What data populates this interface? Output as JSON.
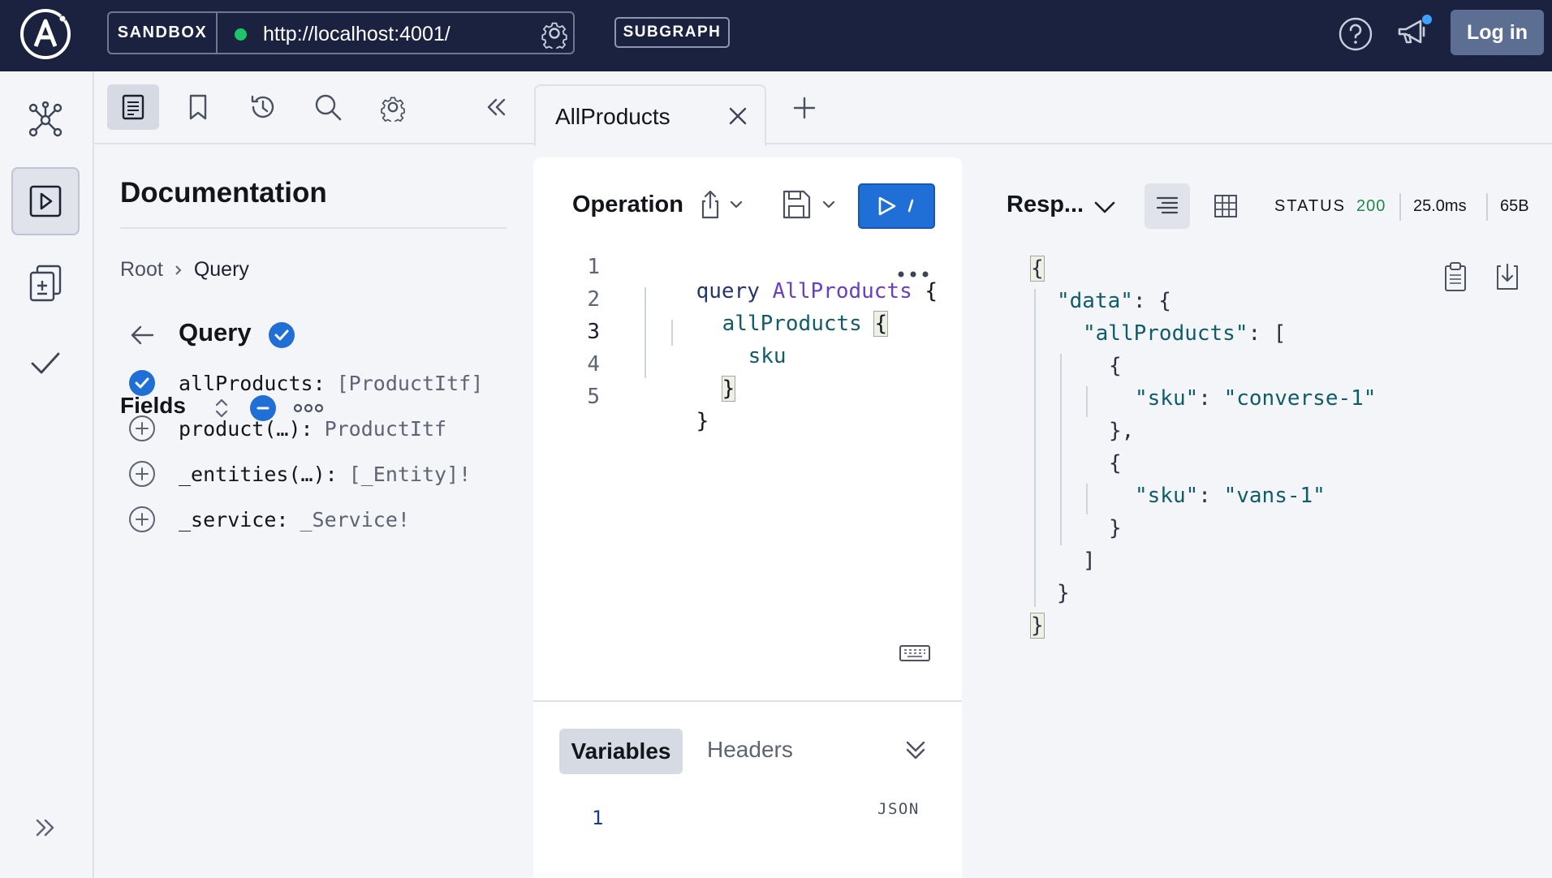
{
  "topbar": {
    "mode_label": "SANDBOX",
    "endpoint_url": "http://localhost:4001/",
    "subgraph_badge": "SUBGRAPH",
    "login_label": "Log in"
  },
  "rail": {
    "items": [
      "schema-icon",
      "explorer-icon",
      "checks-icon",
      "check-icon"
    ],
    "active": "explorer-icon"
  },
  "docs": {
    "title": "Documentation",
    "breadcrumb": [
      "Root",
      "Query"
    ],
    "type_title": "Query",
    "fields_label": "Fields",
    "fields": [
      {
        "name": "allProducts:",
        "type": "[ProductItf]",
        "selected": true
      },
      {
        "name": "product(…):",
        "type": "ProductItf",
        "selected": false
      },
      {
        "name": "_entities(…):",
        "type": "[_Entity]!",
        "selected": false
      },
      {
        "name": "_service:",
        "type": "_Service!",
        "selected": false
      }
    ]
  },
  "tabs": [
    {
      "label": "AllProducts",
      "active": true
    }
  ],
  "operation": {
    "title": "Operation",
    "line_numbers": [
      "1",
      "2",
      "3",
      "4",
      "5"
    ],
    "current_line": "3",
    "code": {
      "l1_kw": "query",
      "l1_name": "AllProducts",
      "l1_brace": "{",
      "l2_field": "allProducts",
      "l2_brace": "{",
      "l3_field": "sku",
      "l4_brace": "}",
      "l5_brace": "}"
    }
  },
  "variables": {
    "tab_label": "Variables",
    "headers_label": "Headers",
    "format_label": "JSON",
    "line1": "1"
  },
  "response": {
    "selector_label": "Resp...",
    "status_label": "STATUS",
    "status_code": "200",
    "time": "25.0ms",
    "size": "65B",
    "lines": {
      "l1": "{",
      "l2_key": "\"data\"",
      "l2_rest": ": {",
      "l3_key": "\"allProducts\"",
      "l3_rest": ": [",
      "l4": "{",
      "l5_key": "\"sku\"",
      "l5_sep": ": ",
      "l5_val": "\"converse-1\"",
      "l6": "},",
      "l7": "{",
      "l8_key": "\"sku\"",
      "l8_sep": ": ",
      "l8_val": "\"vans-1\"",
      "l9": "}",
      "l10": "]",
      "l11": "}",
      "l12": "}"
    }
  },
  "colors": {
    "topbar_bg": "#1b2240",
    "run_button": "#1f6fd6",
    "check_blue": "#1f6fd6",
    "status_green": "#1e8a4a",
    "status_dot": "#1ec46a"
  }
}
